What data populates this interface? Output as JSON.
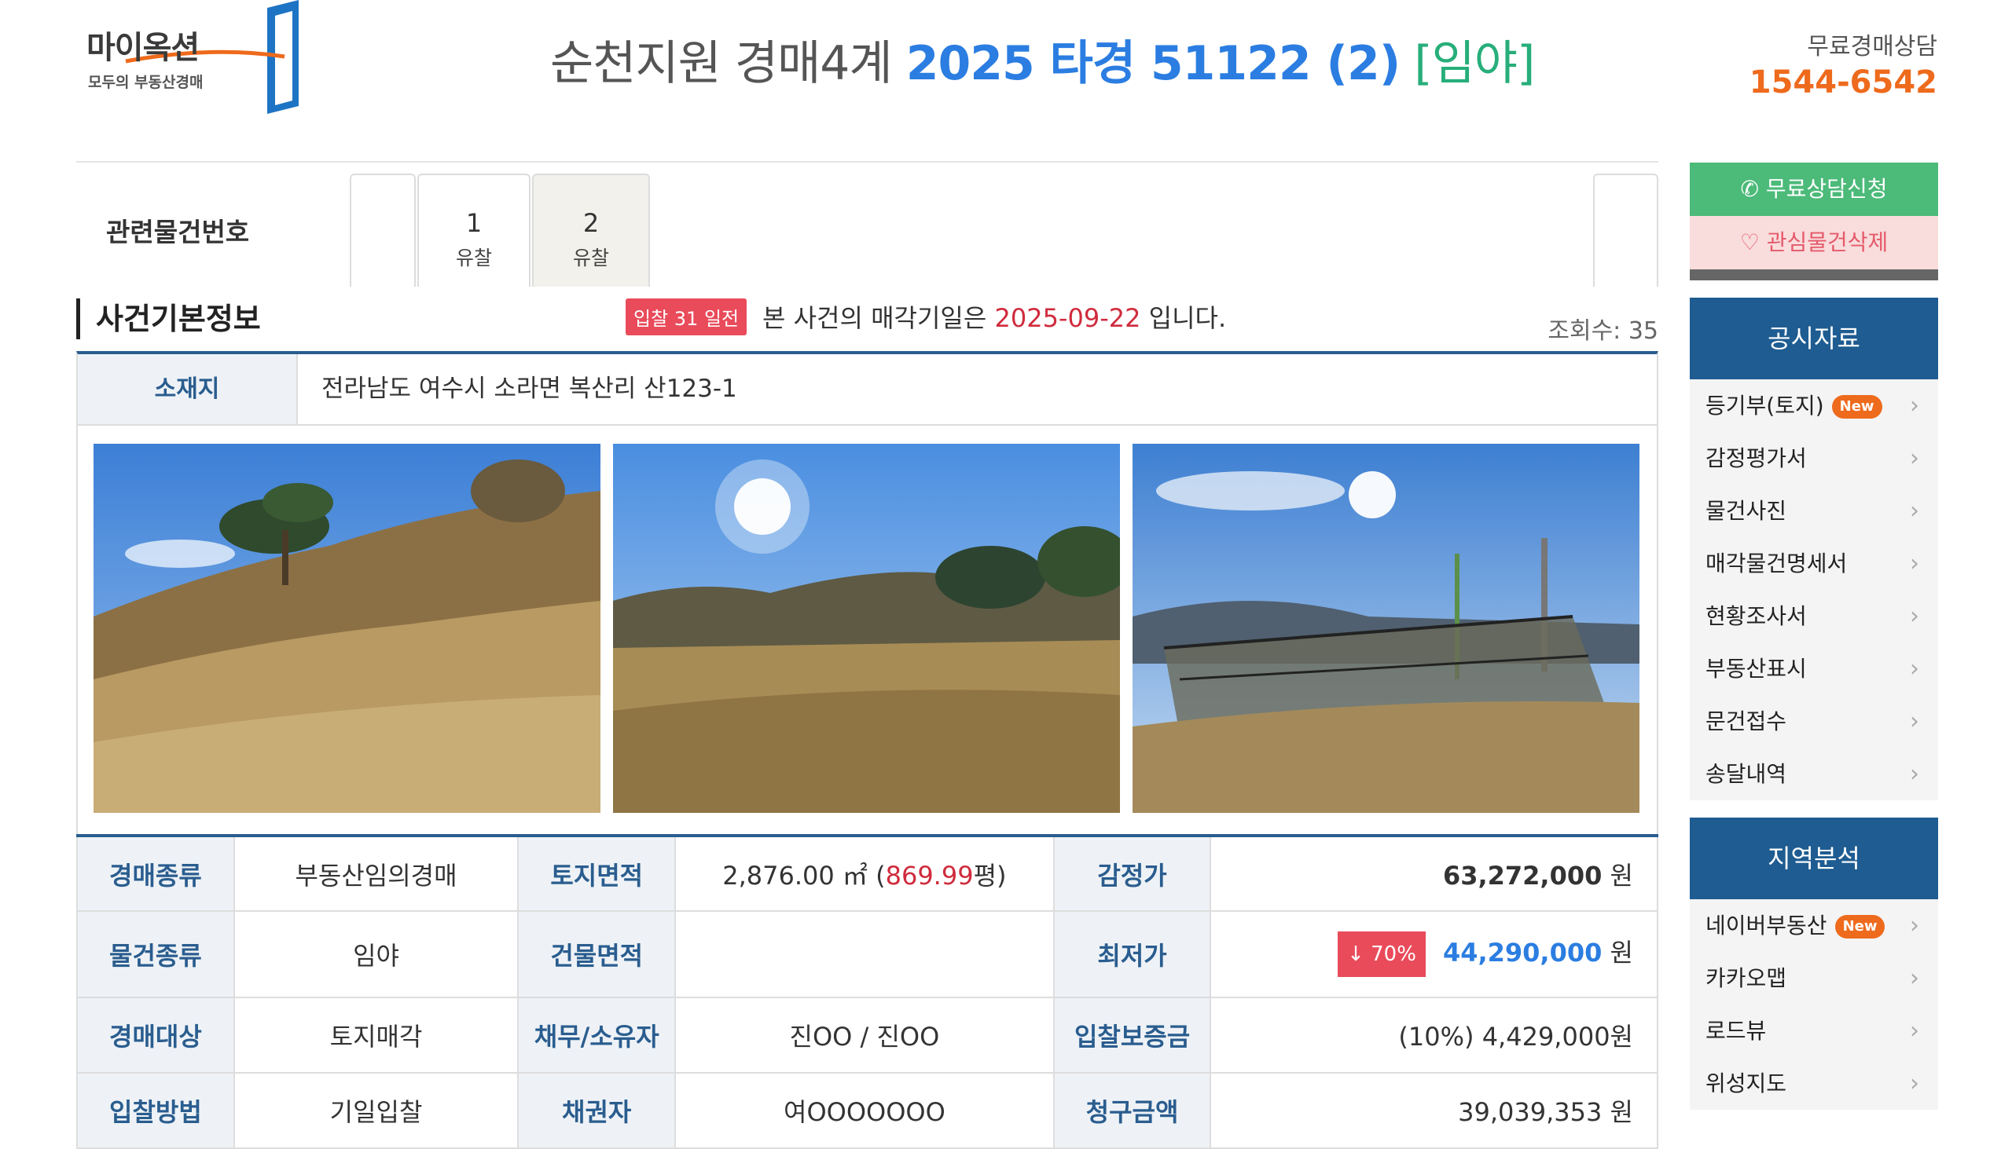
{
  "header": {
    "logo_text": "마이옥션",
    "logo_sub": "모두의 부동산경매",
    "court": "순천지원 경매4계",
    "case_no": "2025 타경 51122 (2)",
    "kind": "[임야]",
    "consult_label": "무료경매상담",
    "phone": "1544-6542"
  },
  "related": {
    "label": "관련물건번호",
    "tabs": [
      {
        "num": "1",
        "status": "유찰"
      },
      {
        "num": "2",
        "status": "유찰"
      }
    ]
  },
  "basic": {
    "title": "사건기본정보",
    "dday": "입찰 31 일전",
    "notice_prefix": "본 사건의 매각기일은",
    "sale_date": "2025-09-22",
    "notice_suffix": "입니다.",
    "views": "조회수: 35"
  },
  "location": {
    "label": "소재지",
    "address": "전라남도 여수시 소라면 복산리 산123-1"
  },
  "info": {
    "auction_type_k": "경매종류",
    "auction_type_v": "부동산임의경매",
    "land_area_k": "토지면적",
    "land_area_m2": "2,876.00 ㎡ (",
    "land_area_py": "869.99",
    "land_area_unit": "평)",
    "appraisal_k": "감정가",
    "appraisal_v": "63,272,000",
    "won": "원",
    "item_type_k": "물건종류",
    "item_type_v": "임야",
    "bldg_area_k": "건물면적",
    "bldg_area_v": "",
    "min_price_k": "최저가",
    "min_rate": "↓ 70%",
    "min_price_v": "44,290,000",
    "target_k": "경매대상",
    "target_v": "토지매각",
    "owner_k": "채무/소유자",
    "owner_v": "진OO / 진OO",
    "deposit_k": "입찰보증금",
    "deposit_v": "(10%) 4,429,000원",
    "method_k": "입찰방법",
    "method_v": "기일입찰",
    "creditor_k": "채권자",
    "creditor_v": "여OOOOOOO",
    "claim_k": "청구금액",
    "claim_v": "39,039,353 원"
  },
  "sidebar": {
    "consult_btn": "무료상담신청",
    "fav_btn": "관심물건삭제",
    "docs_title": "공시자료",
    "docs": [
      "등기부(토지)",
      "감정평가서",
      "물건사진",
      "매각물건명세서",
      "현황조사서",
      "부동산표시",
      "문건접수",
      "송달내역"
    ],
    "new_badge": "New",
    "region_title": "지역분석",
    "region": [
      "네이버부동산",
      "카카오맵",
      "로드뷰",
      "위성지도"
    ]
  },
  "colors": {
    "accent": "#2b7de1",
    "navy": "#1e5c91",
    "green": "#4cba79",
    "red": "#e94b5b",
    "orange": "#ee6a1c"
  }
}
